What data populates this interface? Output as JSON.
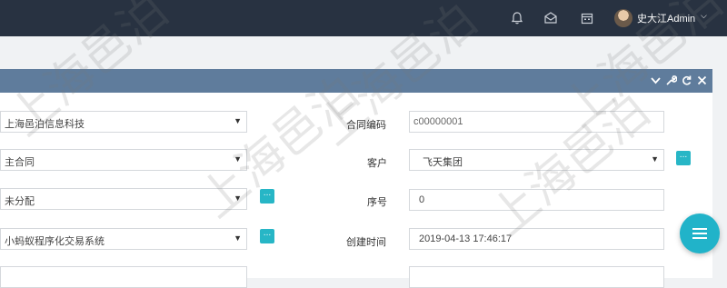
{
  "header": {
    "username": "史大江Admin",
    "icons": [
      "bell-icon",
      "mail-icon",
      "calendar-icon"
    ]
  },
  "panel": {
    "head_icons": [
      "chevron-down-icon",
      "wrench-icon",
      "refresh-icon",
      "close-icon"
    ]
  },
  "form": {
    "company_value": "上海邑泊信息科技",
    "contract_type_value": "主合同",
    "assign_value": "未分配",
    "system_value": "小蚂蚁程序化交易系统",
    "contract_code_label": "合同编码",
    "contract_code_value": "c00000001",
    "customer_label": "客户",
    "customer_value": "飞天集团",
    "serial_label": "序号",
    "serial_value": "0",
    "created_label": "创建时间",
    "created_value": "2019-04-13 17:46:17",
    "more_label": "..."
  },
  "watermark_text": "上海邑泊"
}
